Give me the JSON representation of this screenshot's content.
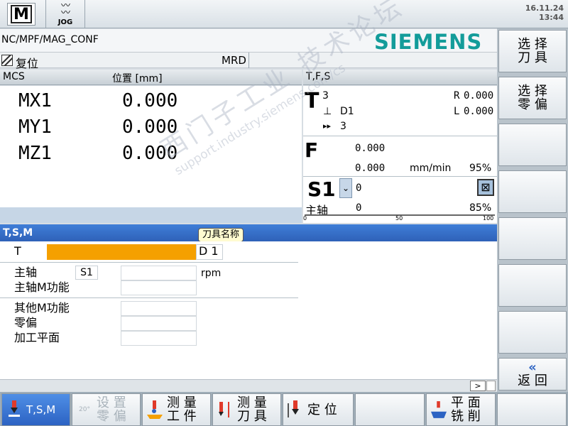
{
  "header": {
    "mode_m_label": "M",
    "jog_label": "JOG",
    "date": "16.11.24",
    "time": "13:44"
  },
  "program": {
    "path": "NC/MPF/MAG_CONF",
    "brand": "SIEMENS",
    "status_text": "复位",
    "mrd": "MRD"
  },
  "mcs": {
    "title": "MCS",
    "position_header": "位置 [mm]",
    "axes": [
      {
        "name": "MX1",
        "value": "0.000"
      },
      {
        "name": "MY1",
        "value": "0.000"
      },
      {
        "name": "MZ1",
        "value": "0.000"
      }
    ]
  },
  "tfs": {
    "title": "T,F,S",
    "t_label": "T",
    "tool_number": "3",
    "d_label": "D1",
    "next_tool": "3",
    "r_label": "R",
    "r_value": "0.000",
    "l_label": "L",
    "l_value": "0.000",
    "f_label": "F",
    "f_set": "0.000",
    "f_actual": "0.000",
    "f_unit": "mm/min",
    "f_override": "95%",
    "spindle_label": "S1",
    "spindle_value": "0",
    "spindle_text": "主轴",
    "spindle_actual": "0",
    "spindle_override": "85%",
    "scale_0": "0",
    "scale_50": "50",
    "scale_100": "100",
    "spindle_override_pct": 85
  },
  "tsm": {
    "title": "T,S,M",
    "tooltip": "刀具名称",
    "t_label": "T",
    "t_value": "",
    "d_label": "D 1",
    "spindle_label": "主轴",
    "spindle_select": "S1",
    "spindle_speed": "",
    "spindle_unit": "rpm",
    "spindle_m_label": "主轴M功能",
    "spindle_m_value": "",
    "other_m_label": "其他M功能",
    "other_m_value": "",
    "zero_offset_label": "零偏",
    "zero_offset_value": "",
    "plane_label": "加工平面",
    "plane_value": "",
    "scroll_label": ">"
  },
  "softkeys_right": [
    {
      "line1": "选 择",
      "line2": "刀 具"
    },
    {
      "line1": "选 择",
      "line2": "零 偏"
    },
    {
      "line1": "",
      "line2": ""
    },
    {
      "line1": "",
      "line2": ""
    },
    {
      "line1": "",
      "line2": ""
    },
    {
      "line1": "",
      "line2": ""
    },
    {
      "line1": "",
      "line2": ""
    },
    {
      "line1": "«",
      "line2": "返 回"
    }
  ],
  "softkeys_bottom": {
    "tsm": "T,S,M",
    "setup_line1": "设 置",
    "setup_line2": "零 偏",
    "setup_icon_text": "20°",
    "measure_wp_line1": "测 量",
    "measure_wp_line2": "工 件",
    "measure_tool_line1": "测 量",
    "measure_tool_line2": "刀 具",
    "position": "定 位",
    "face_line1": "平 面",
    "face_line2": "铣 削"
  },
  "watermark": {
    "line1": "西门子工业 技术论坛",
    "line2": "support.industry.siemens.com/cs"
  },
  "colors": {
    "active_blue": "#2f61b8",
    "siemens_teal": "#139c9a",
    "tool_orange": "#f5a000"
  }
}
